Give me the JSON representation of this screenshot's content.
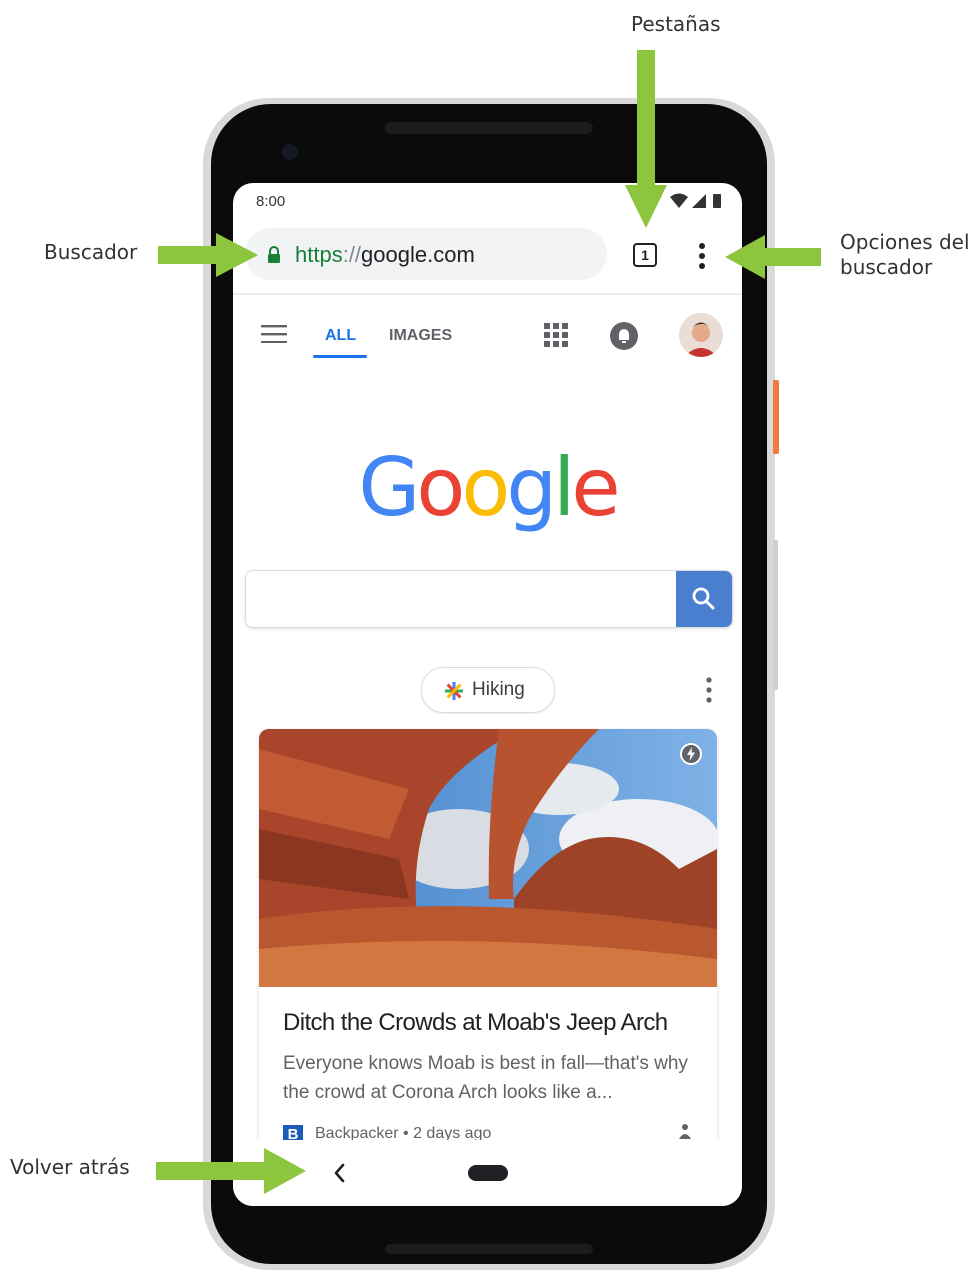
{
  "annotations": {
    "tabs": "Pestañas",
    "search_bar": "Buscador",
    "browser_options_line1": "Opciones del",
    "browser_options_line2": "buscador",
    "go_back": "Volver atrás"
  },
  "colors": {
    "arrow": "#8cc63e",
    "google_blue": "#4285f4",
    "google_red": "#ea4335",
    "google_yellow": "#fbbc05",
    "google_green": "#34a853",
    "secure_green": "#188038"
  },
  "status_bar": {
    "time": "8:00",
    "icons": [
      "wifi-icon",
      "signal-icon",
      "battery-icon"
    ]
  },
  "browser": {
    "url_scheme": "https",
    "url_separator": "://",
    "url_host": "google.com",
    "tab_count": "1"
  },
  "google_nav": {
    "tabs": [
      {
        "label": "ALL",
        "active": true
      },
      {
        "label": "IMAGES",
        "active": false
      }
    ]
  },
  "logo": {
    "letters": [
      "G",
      "o",
      "o",
      "g",
      "l",
      "e"
    ]
  },
  "search": {
    "value": ""
  },
  "chip": {
    "label": "Hiking"
  },
  "card": {
    "title": "Ditch the Crowds at Moab's Jeep Arch",
    "snippet": "Everyone knows Moab is best in fall—that's why the crowd at Corona Arch looks like a...",
    "source_logo": "B",
    "source": "Backpacker • 2 days ago"
  }
}
